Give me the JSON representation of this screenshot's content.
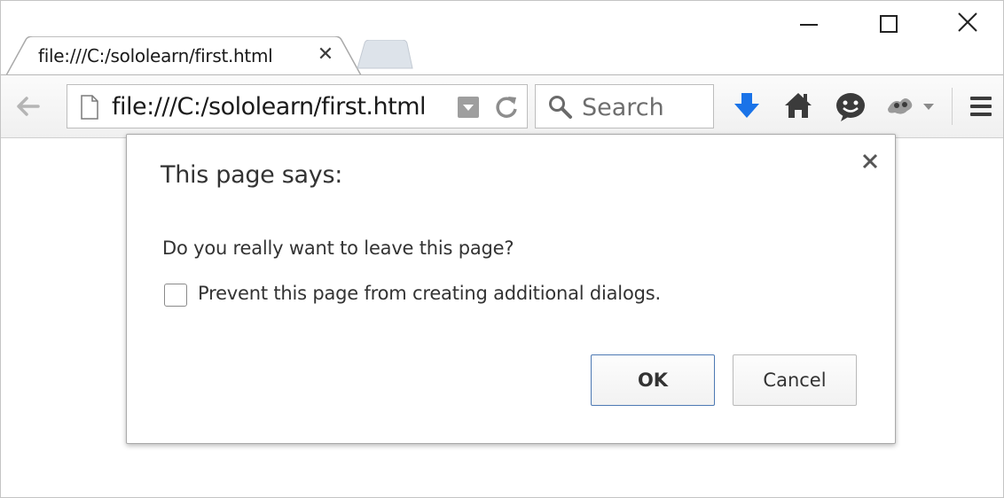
{
  "browser": {
    "tab": {
      "title": "file:///C:/sololearn/first.html",
      "close_glyph": "✕"
    },
    "window_controls": [
      "minimize",
      "maximize",
      "close"
    ]
  },
  "toolbar": {
    "url": "file:///C:/sololearn/first.html",
    "search_placeholder": "Search",
    "icons": [
      "back-arrow-icon",
      "page-icon",
      "dropdown-icon",
      "reload-icon",
      "search-icon",
      "download-icon",
      "home-icon",
      "chat-icon",
      "extension-icon",
      "menu-icon"
    ]
  },
  "dialog": {
    "title": "This page says:",
    "message": "Do you really want to leave this page?",
    "checkbox_label": "Prevent this page from creating additional dialogs.",
    "checkbox_checked": false,
    "ok_label": "OK",
    "cancel_label": "Cancel"
  },
  "colors": {
    "download_arrow": "#1a73e8",
    "ok_border": "#4d79b3"
  }
}
